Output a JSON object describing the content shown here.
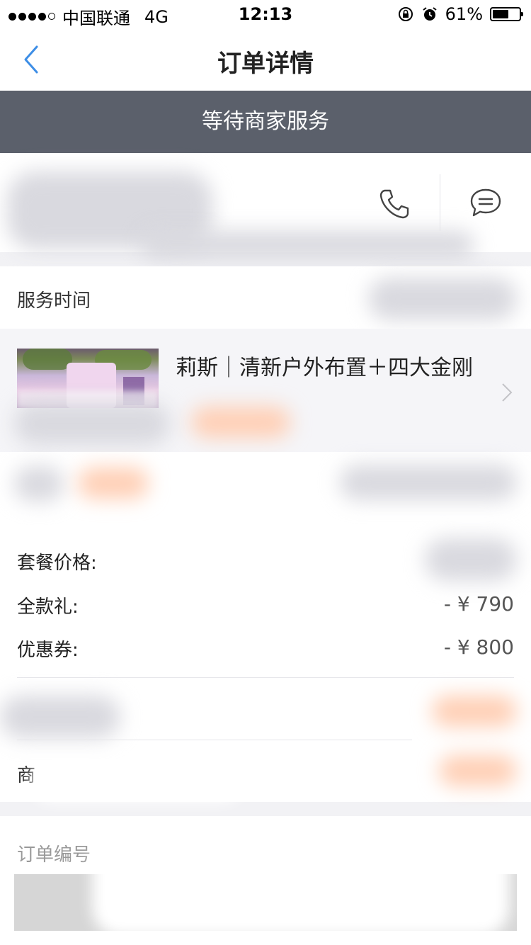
{
  "status_bar": {
    "carrier": "中国联通",
    "network": "4G",
    "time": "12:13",
    "battery": "61%",
    "battery_level": 0.61
  },
  "nav": {
    "title": "订单详情"
  },
  "banner": {
    "status": "等待商家服务"
  },
  "service": {
    "time_label": "服务时间"
  },
  "product": {
    "title": "莉斯｜清新户外布置＋四大金刚"
  },
  "pricing": {
    "package_label": "套餐价格:",
    "full_payment_label": "全款礼:",
    "full_payment_value": "- ¥ 790",
    "coupon_label": "优惠券:",
    "coupon_value": "- ¥ 800",
    "merchant_label_partial": "商"
  },
  "order": {
    "number_label": "订单编号"
  },
  "colors": {
    "banner_bg": "#5b606b",
    "accent_blue": "#3d8ee6",
    "page_bg": "#f2f2f5"
  }
}
